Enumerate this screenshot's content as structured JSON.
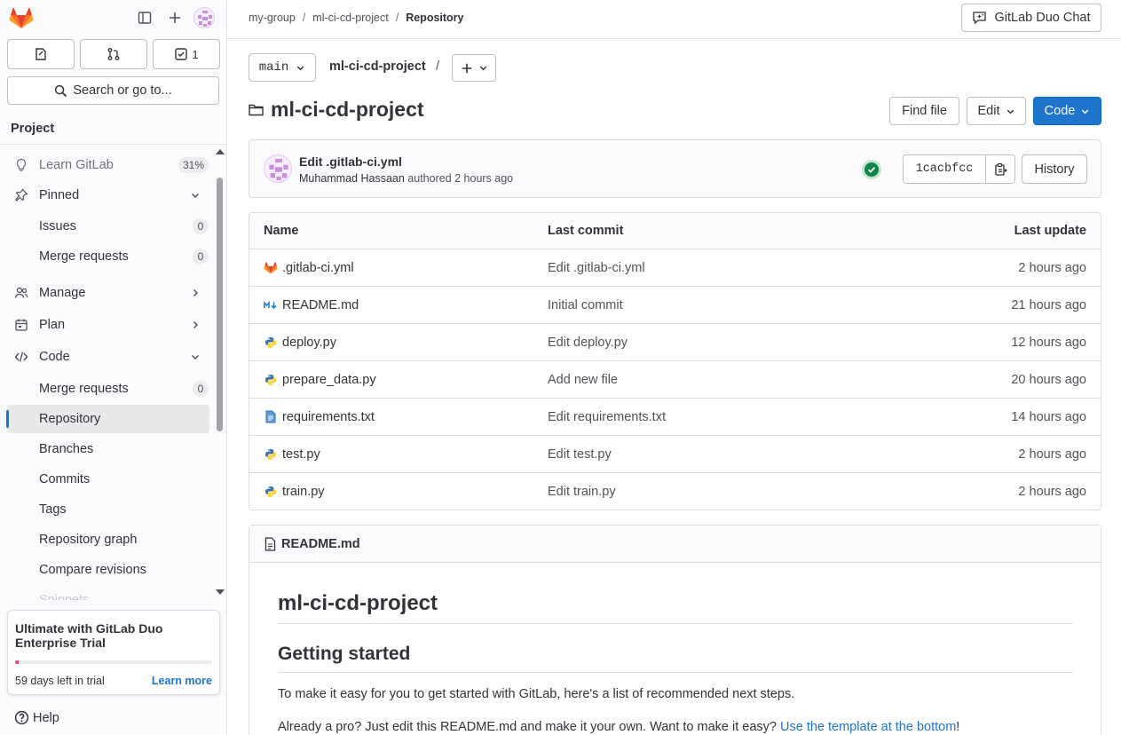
{
  "sidebar": {
    "counts": {
      "todo": "1"
    },
    "search_label": "Search or go to...",
    "section_title": "Project",
    "items": [
      {
        "label": "Learn GitLab",
        "badge": "31%"
      },
      {
        "label": "Pinned"
      },
      {
        "label": "Issues",
        "badge": "0"
      },
      {
        "label": "Merge requests",
        "badge": "0"
      },
      {
        "label": "Manage"
      },
      {
        "label": "Plan"
      },
      {
        "label": "Code"
      },
      {
        "label": "Merge requests",
        "badge": "0"
      },
      {
        "label": "Repository"
      },
      {
        "label": "Branches"
      },
      {
        "label": "Commits"
      },
      {
        "label": "Tags"
      },
      {
        "label": "Repository graph"
      },
      {
        "label": "Compare revisions"
      },
      {
        "label": "Snippets"
      }
    ],
    "trial": {
      "title": "Ultimate with GitLab Duo Enterprise Trial",
      "progress": 0.02,
      "days_left": "59 days left in trial",
      "link": "Learn more"
    },
    "help_label": "Help"
  },
  "topbar": {
    "breadcrumbs": [
      "my-group",
      "ml-ci-cd-project",
      "Repository"
    ],
    "duo_chat_label": "GitLab Duo Chat"
  },
  "repo": {
    "branch": "main",
    "path": "ml-ci-cd-project",
    "path_sep": "/",
    "title": "ml-ci-cd-project",
    "find_file": "Find file",
    "edit": "Edit",
    "code": "Code"
  },
  "commit": {
    "title": "Edit .gitlab-ci.yml",
    "author": "Muhammad Hassaan",
    "authored_text": "authored 2 hours ago",
    "sha": "1cacbfcc",
    "history": "History"
  },
  "files": {
    "headers": {
      "name": "Name",
      "last_commit": "Last commit",
      "last_update": "Last update"
    },
    "rows": [
      {
        "name": ".gitlab-ci.yml",
        "icon": "gitlab-icon",
        "commit": "Edit .gitlab-ci.yml",
        "updated": "2 hours ago"
      },
      {
        "name": "README.md",
        "icon": "markdown-icon",
        "commit": "Initial commit",
        "updated": "21 hours ago"
      },
      {
        "name": "deploy.py",
        "icon": "python-icon",
        "commit": "Edit deploy.py",
        "updated": "12 hours ago"
      },
      {
        "name": "prepare_data.py",
        "icon": "python-icon",
        "commit": "Add new file",
        "updated": "20 hours ago"
      },
      {
        "name": "requirements.txt",
        "icon": "text-file-icon",
        "commit": "Edit requirements.txt",
        "updated": "14 hours ago"
      },
      {
        "name": "test.py",
        "icon": "python-icon",
        "commit": "Edit test.py",
        "updated": "2 hours ago"
      },
      {
        "name": "train.py",
        "icon": "python-icon",
        "commit": "Edit train.py",
        "updated": "2 hours ago"
      }
    ]
  },
  "readme": {
    "filename": "README.md",
    "h1": "ml-ci-cd-project",
    "h2": "Getting started",
    "p1": "To make it easy for you to get started with GitLab, here's a list of recommended next steps.",
    "p2_text": "Already a pro? Just edit this README.md and make it your own. Want to make it easy? ",
    "p2_link": "Use the template at the bottom",
    "p2_end": "!"
  },
  "colors": {
    "accent": "#1f75cb",
    "success": "#108548",
    "trial": "#e24a85"
  }
}
